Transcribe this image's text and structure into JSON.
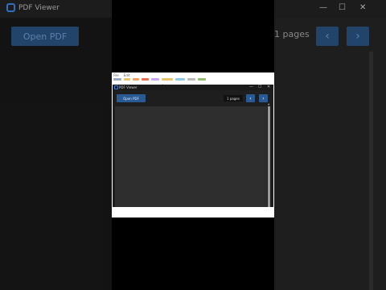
{
  "app": {
    "title": "PDF Viewer",
    "open_label": "Open PDF",
    "pages_label": "1 pages",
    "prev_icon": "‹",
    "next_icon": "›",
    "minimize": "—",
    "maximize": "☐",
    "close": "✕"
  },
  "background": {
    "title": "PDF Viewer",
    "open_label": "Open PDF",
    "pages_label": "1 pages",
    "prev_icon": "‹",
    "next_icon": "›",
    "minimize": "—",
    "maximize": "☐",
    "close": "✕"
  },
  "browser": {
    "menu": [
      "File",
      "Edit"
    ]
  },
  "colors": {
    "accent": "#2a5a93",
    "viewer_bg": "#2e2e2e",
    "app_bg": "#1e1e1e"
  }
}
